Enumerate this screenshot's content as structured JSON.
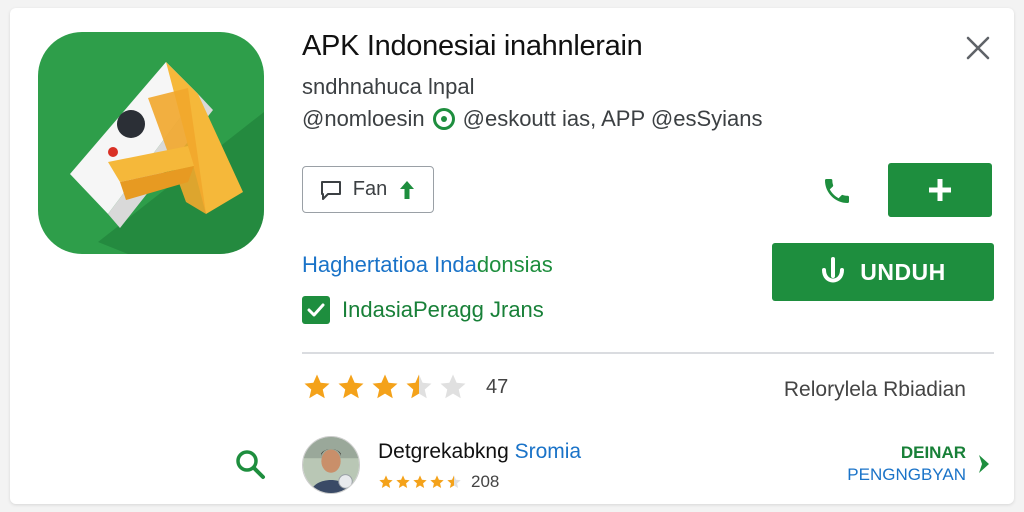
{
  "app": {
    "title": "APK Indonesiai inahnlerain",
    "subtitle": "sndhnahuca lnpal",
    "meta_left": "@nomloesin",
    "meta_right": "@eskoutt ias, APP @esSyians",
    "link_text_a": "Haghertatioa Inda",
    "link_text_b": "donsias",
    "verified_label": "IndasiaPeragg Jrans"
  },
  "actions": {
    "fan_label": "Fan",
    "install_label": "UNDUH"
  },
  "rating": {
    "stars": 3.5,
    "count": "47",
    "reviews_link": "Relorylela Rbiadian"
  },
  "developer": {
    "name_a": "Detgrekabkng",
    "name_b": "Sromia",
    "stars": 4.5,
    "count": "208",
    "more_line1": "DEINAR",
    "more_line2": "PENGNGBYAN"
  },
  "colors": {
    "brand_green": "#1e8e3e",
    "link_blue": "#1a73c8",
    "star_orange": "#f4a21a",
    "icon_bg": "#2e9e4a",
    "icon_yellow": "#f5b83a"
  },
  "icons": [
    "close-icon",
    "comment-icon",
    "upload-arrow-icon",
    "phone-icon",
    "plus-icon",
    "download-icon",
    "check-icon",
    "star-icon",
    "search-icon",
    "chevron-right-icon"
  ]
}
